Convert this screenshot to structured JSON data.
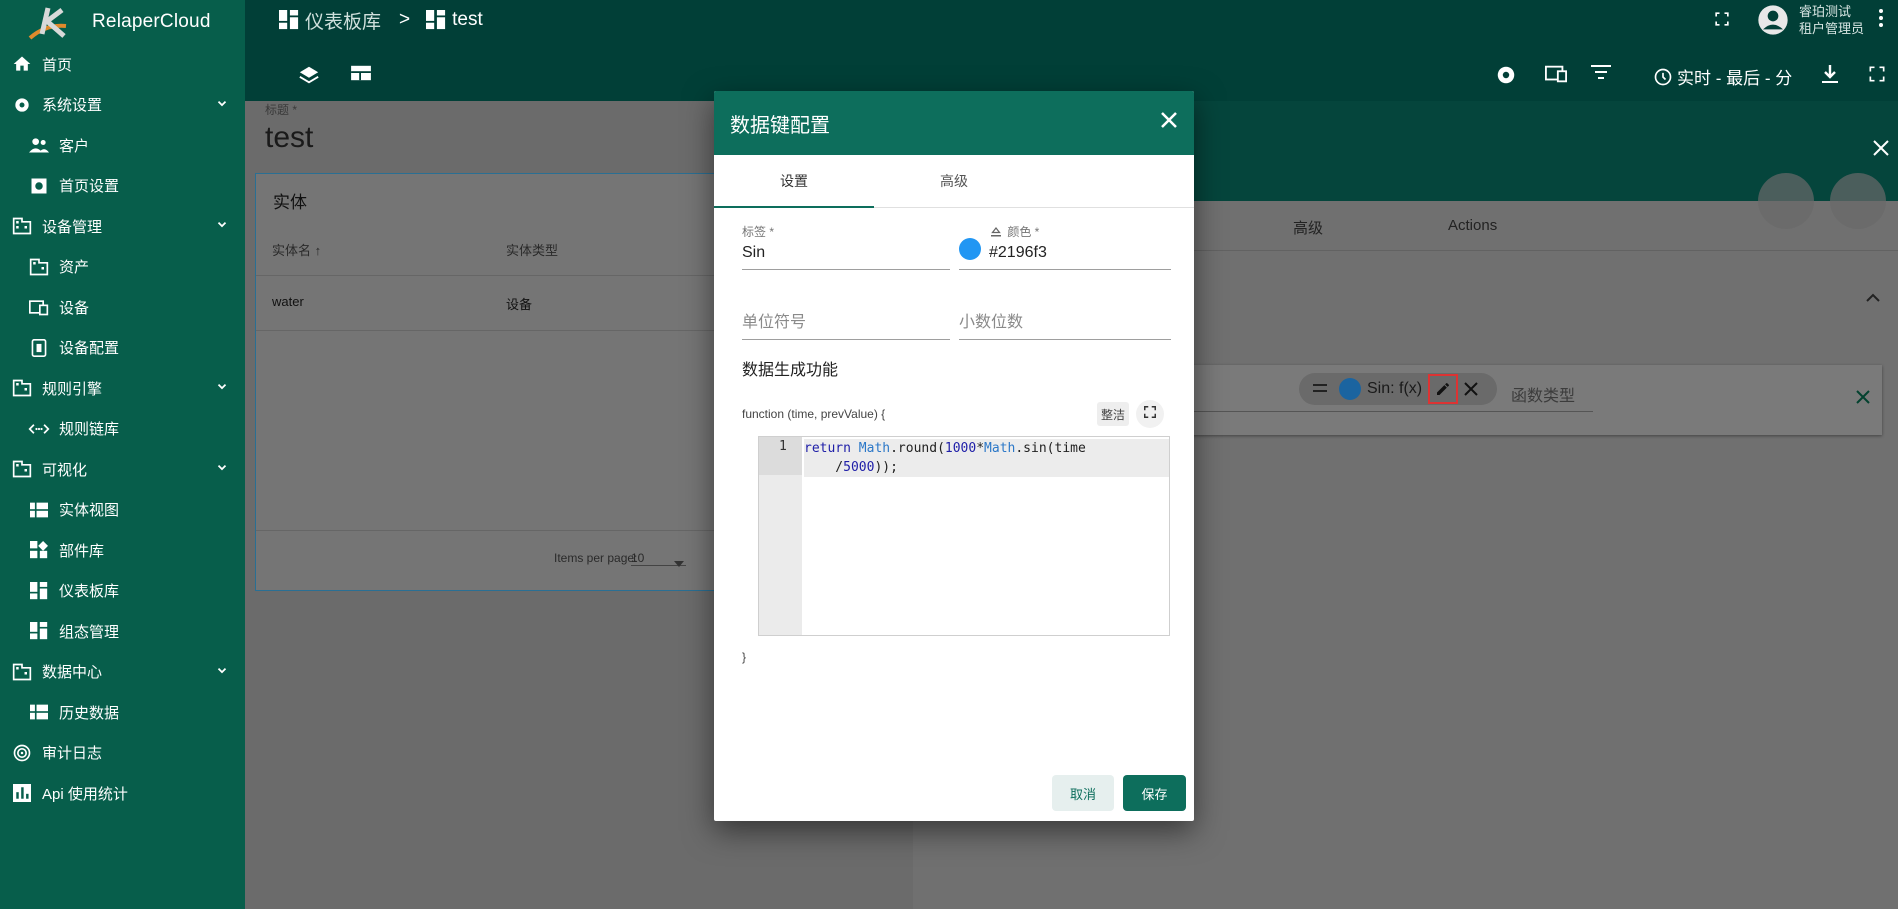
{
  "app": {
    "name": "RelaperCloud"
  },
  "breadcrumb": {
    "parent": "仪表板库",
    "separator": ">",
    "current": "test"
  },
  "user": {
    "name": "睿珀测试",
    "role": "租户管理员"
  },
  "toolbar": {
    "time_label": "实时 - 最后 - 分"
  },
  "sidebar": {
    "items": [
      {
        "label": "首页",
        "icon": "home-icon"
      },
      {
        "label": "系统设置",
        "icon": "gear-icon"
      },
      {
        "label": "客户",
        "icon": "people-icon"
      },
      {
        "label": "首页设置",
        "icon": "settings-box-icon"
      },
      {
        "label": "设备管理",
        "icon": "building-icon"
      },
      {
        "label": "资产",
        "icon": "building-icon"
      },
      {
        "label": "设备",
        "icon": "devices-icon"
      },
      {
        "label": "设备配置",
        "icon": "device-profile-icon"
      },
      {
        "label": "规则引擎",
        "icon": "building-icon"
      },
      {
        "label": "规则链库",
        "icon": "code-arrows-icon"
      },
      {
        "label": "可视化",
        "icon": "building-icon"
      },
      {
        "label": "实体视图",
        "icon": "grid-icon"
      },
      {
        "label": "部件库",
        "icon": "widgets-icon"
      },
      {
        "label": "仪表板库",
        "icon": "dashboard-icon"
      },
      {
        "label": "组态管理",
        "icon": "dashboard-icon"
      },
      {
        "label": "数据中心",
        "icon": "building-icon"
      },
      {
        "label": "历史数据",
        "icon": "grid-icon"
      },
      {
        "label": "审计日志",
        "icon": "track-icon"
      },
      {
        "label": "Api 使用统计",
        "icon": "bar-chart-icon"
      }
    ]
  },
  "page": {
    "title_label": "标题 *",
    "title_value": "test"
  },
  "entity_table": {
    "heading": "实体",
    "columns": [
      "实体名 ↑",
      "实体类型"
    ],
    "rows": [
      {
        "name": "water",
        "type": "设备"
      }
    ],
    "items_per_page_label": "Items per page:",
    "items_per_page_value": "10"
  },
  "right_panel": {
    "tabs": [
      "高级",
      "Actions"
    ],
    "chip_label": "Sin: f(x)",
    "function_type_placeholder": "函数类型"
  },
  "dialog": {
    "title": "数据键配置",
    "tabs": [
      "设置",
      "高级"
    ],
    "label_field": {
      "label": "标签 *",
      "value": "Sin"
    },
    "color_field": {
      "label": "颜色 *",
      "value": "#2196f3",
      "display": "#2196f3"
    },
    "unit_placeholder": "单位符号",
    "decimals_placeholder": "小数位数",
    "section_title": "数据生成功能",
    "function_signature": "function (time, prevValue) {",
    "tidy_label": "整洁",
    "code_line_number": "1",
    "code_closing": "}",
    "cancel_label": "取消",
    "save_label": "保存"
  },
  "colors": {
    "primary": "#0d6e5c",
    "sidebar": "#075e4b",
    "topbar": "#013f37",
    "accent_blue": "#2196f3"
  }
}
